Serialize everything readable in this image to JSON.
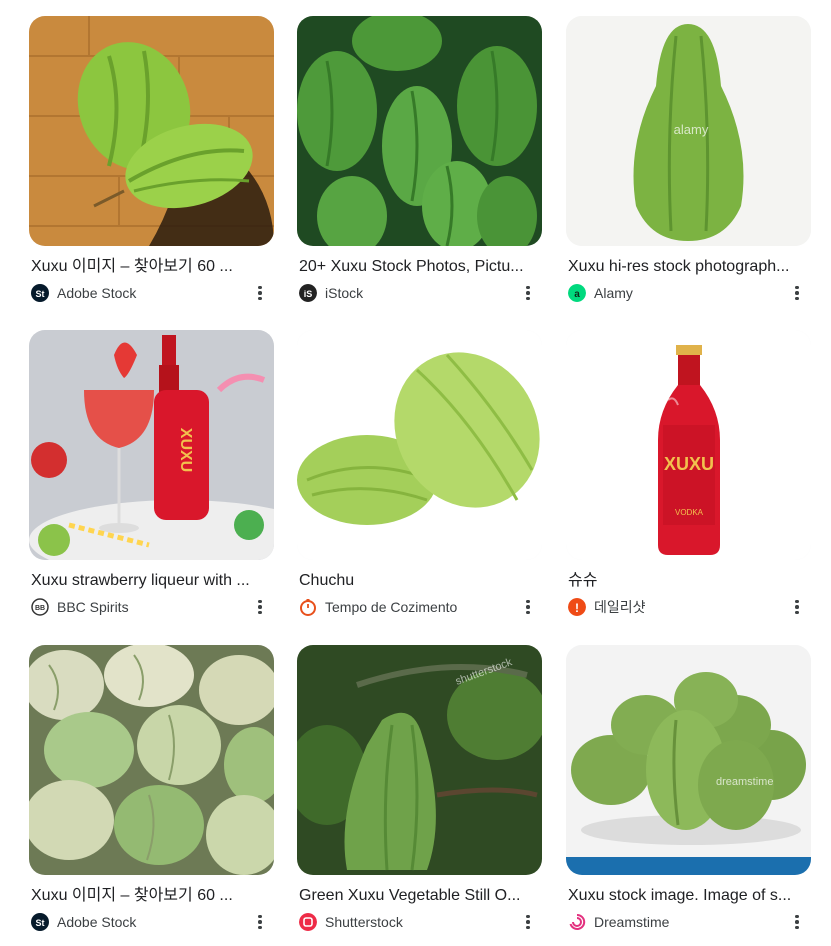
{
  "results": [
    {
      "title": "Xuxu 이미지 – 찾아보기 60 ...",
      "source": "Adobe Stock",
      "favicon": "adobe-stock-icon"
    },
    {
      "title": "20+ Xuxu Stock Photos, Pictu...",
      "source": "iStock",
      "favicon": "istock-icon"
    },
    {
      "title": "Xuxu hi-res stock photograph...",
      "source": "Alamy",
      "favicon": "alamy-icon"
    },
    {
      "title": "Xuxu strawberry liqueur with ...",
      "source": "BBC Spirits",
      "favicon": "bbc-spirits-icon"
    },
    {
      "title": "Chuchu",
      "source": "Tempo de Cozimento",
      "favicon": "tempo-de-cozimento-icon"
    },
    {
      "title": "슈슈",
      "source": "데일리샷",
      "favicon": "dailyshot-icon"
    },
    {
      "title": "Xuxu 이미지 – 찾아보기 60 ...",
      "source": "Adobe Stock",
      "favicon": "adobe-stock-icon"
    },
    {
      "title": "Green Xuxu Vegetable Still O...",
      "source": "Shutterstock",
      "favicon": "shutterstock-icon"
    },
    {
      "title": "Xuxu stock image. Image of s...",
      "source": "Dreamstime",
      "favicon": "dreamstime-icon"
    }
  ],
  "image_text": {
    "bottle_label": "XUXU",
    "bottle_label_small": "VODKA",
    "watermark_alamy": "alamy",
    "watermark_shutterstock": "shutterstock",
    "watermark_dreamstime": "dreamstime"
  },
  "favicon_text": {
    "adobe": "St",
    "istock": "iS",
    "alamy": "a",
    "bbc": "BB",
    "dailyshot": "!"
  },
  "colors": {
    "text": "#202124",
    "source_text": "#3c4043",
    "thumb_bg": "#f1f3f4",
    "chayote_green": "#8cc63f",
    "liqueur_red": "#d9172b"
  }
}
